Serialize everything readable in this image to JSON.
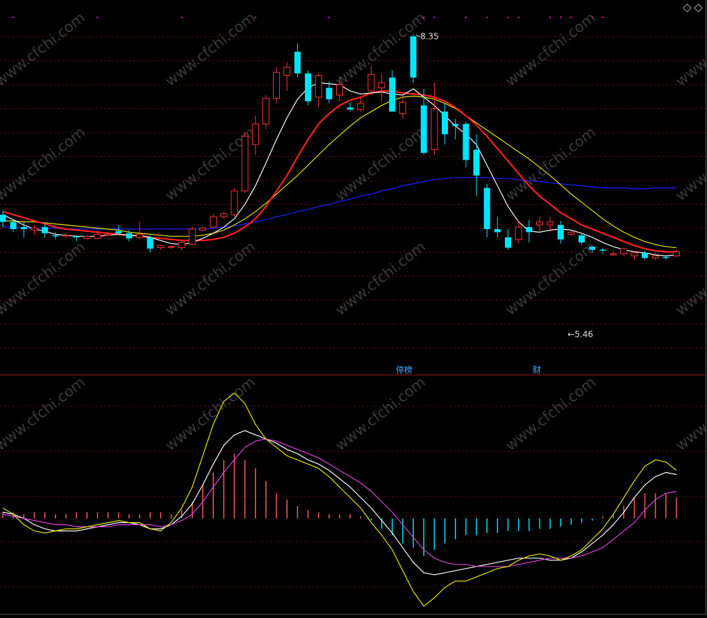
{
  "chart_data": [
    {
      "type": "candlestick",
      "title": "",
      "ylim": [
        5.2,
        8.5
      ],
      "x_count": 65,
      "colors": {
        "up": "#ff3333",
        "down": "#00e5ff",
        "ma5": "#ffffff",
        "ma10": "#ff2020",
        "ma20": "#e6e600",
        "ma60": "#2020ff"
      },
      "candles": [
        {
          "o": 6.62,
          "h": 6.66,
          "l": 6.5,
          "c": 6.55
        },
        {
          "o": 6.55,
          "h": 6.58,
          "l": 6.45,
          "c": 6.48
        },
        {
          "o": 6.5,
          "h": 6.55,
          "l": 6.4,
          "c": 6.48
        },
        {
          "o": 6.47,
          "h": 6.52,
          "l": 6.43,
          "c": 6.49
        },
        {
          "o": 6.5,
          "h": 6.54,
          "l": 6.4,
          "c": 6.44
        },
        {
          "o": 6.42,
          "h": 6.45,
          "l": 6.38,
          "c": 6.41
        },
        {
          "o": 6.42,
          "h": 6.44,
          "l": 6.39,
          "c": 6.42
        },
        {
          "o": 6.41,
          "h": 6.42,
          "l": 6.36,
          "c": 6.4
        },
        {
          "o": 6.39,
          "h": 6.42,
          "l": 6.38,
          "c": 6.41
        },
        {
          "o": 6.39,
          "h": 6.46,
          "l": 6.38,
          "c": 6.43
        },
        {
          "o": 6.42,
          "h": 6.45,
          "l": 6.41,
          "c": 6.43
        },
        {
          "o": 6.46,
          "h": 6.52,
          "l": 6.43,
          "c": 6.44
        },
        {
          "o": 6.44,
          "h": 6.47,
          "l": 6.36,
          "c": 6.39
        },
        {
          "o": 6.4,
          "h": 6.55,
          "l": 6.38,
          "c": 6.43
        },
        {
          "o": 6.4,
          "h": 6.42,
          "l": 6.25,
          "c": 6.29
        },
        {
          "o": 6.3,
          "h": 6.33,
          "l": 6.28,
          "c": 6.32
        },
        {
          "o": 6.31,
          "h": 6.32,
          "l": 6.29,
          "c": 6.31
        },
        {
          "o": 6.3,
          "h": 6.38,
          "l": 6.27,
          "c": 6.35
        },
        {
          "o": 6.33,
          "h": 6.5,
          "l": 6.32,
          "c": 6.48
        },
        {
          "o": 6.47,
          "h": 6.5,
          "l": 6.46,
          "c": 6.49
        },
        {
          "o": 6.5,
          "h": 6.63,
          "l": 6.49,
          "c": 6.6
        },
        {
          "o": 6.6,
          "h": 6.65,
          "l": 6.58,
          "c": 6.63
        },
        {
          "o": 6.62,
          "h": 6.88,
          "l": 6.6,
          "c": 6.85
        },
        {
          "o": 6.85,
          "h": 7.42,
          "l": 6.83,
          "c": 7.38
        },
        {
          "o": 7.3,
          "h": 7.58,
          "l": 7.2,
          "c": 7.5
        },
        {
          "o": 7.5,
          "h": 7.78,
          "l": 7.45,
          "c": 7.75
        },
        {
          "o": 7.75,
          "h": 8.05,
          "l": 7.7,
          "c": 8.0
        },
        {
          "o": 7.97,
          "h": 8.1,
          "l": 7.82,
          "c": 8.05
        },
        {
          "o": 8.2,
          "h": 8.28,
          "l": 7.95,
          "c": 7.99
        },
        {
          "o": 7.99,
          "h": 8.02,
          "l": 7.68,
          "c": 7.72
        },
        {
          "o": 7.76,
          "h": 7.99,
          "l": 7.66,
          "c": 7.97
        },
        {
          "o": 7.85,
          "h": 7.91,
          "l": 7.7,
          "c": 7.74
        },
        {
          "o": 7.78,
          "h": 7.96,
          "l": 7.72,
          "c": 7.88
        },
        {
          "o": 7.66,
          "h": 7.71,
          "l": 7.62,
          "c": 7.64
        },
        {
          "o": 7.64,
          "h": 7.76,
          "l": 7.62,
          "c": 7.7
        },
        {
          "o": 7.82,
          "h": 8.06,
          "l": 7.78,
          "c": 7.98
        },
        {
          "o": 7.85,
          "h": 7.99,
          "l": 7.72,
          "c": 7.9
        },
        {
          "o": 7.95,
          "h": 8.02,
          "l": 7.62,
          "c": 7.62
        },
        {
          "o": 7.6,
          "h": 7.78,
          "l": 7.55,
          "c": 7.71
        },
        {
          "o": 8.35,
          "h": 8.37,
          "l": 7.9,
          "c": 7.95
        },
        {
          "o": 7.68,
          "h": 7.84,
          "l": 7.2,
          "c": 7.22
        },
        {
          "o": 7.25,
          "h": 7.9,
          "l": 7.2,
          "c": 7.65
        },
        {
          "o": 7.62,
          "h": 7.7,
          "l": 7.3,
          "c": 7.4
        },
        {
          "o": 7.5,
          "h": 7.55,
          "l": 7.35,
          "c": 7.48
        },
        {
          "o": 7.5,
          "h": 7.52,
          "l": 7.08,
          "c": 7.15
        },
        {
          "o": 7.25,
          "h": 7.4,
          "l": 6.8,
          "c": 7.0
        },
        {
          "o": 6.88,
          "h": 6.92,
          "l": 6.4,
          "c": 6.48
        },
        {
          "o": 6.48,
          "h": 6.6,
          "l": 6.4,
          "c": 6.45
        },
        {
          "o": 6.4,
          "h": 6.48,
          "l": 6.28,
          "c": 6.3
        },
        {
          "o": 6.38,
          "h": 6.56,
          "l": 6.34,
          "c": 6.5
        },
        {
          "o": 6.5,
          "h": 6.57,
          "l": 6.35,
          "c": 6.45
        },
        {
          "o": 6.52,
          "h": 6.6,
          "l": 6.45,
          "c": 6.55
        },
        {
          "o": 6.52,
          "h": 6.6,
          "l": 6.45,
          "c": 6.55
        },
        {
          "o": 6.52,
          "h": 6.56,
          "l": 6.34,
          "c": 6.38
        },
        {
          "o": 6.43,
          "h": 6.47,
          "l": 6.41,
          "c": 6.45
        },
        {
          "o": 6.42,
          "h": 6.44,
          "l": 6.33,
          "c": 6.35
        },
        {
          "o": 6.31,
          "h": 6.3,
          "l": 6.25,
          "c": 6.28
        },
        {
          "o": 6.28,
          "h": 6.3,
          "l": 6.24,
          "c": 6.27
        },
        {
          "o": 6.23,
          "h": 6.27,
          "l": 6.22,
          "c": 6.24
        },
        {
          "o": 6.24,
          "h": 6.3,
          "l": 6.22,
          "c": 6.29
        },
        {
          "o": 6.22,
          "h": 6.27,
          "l": 6.18,
          "c": 6.25
        },
        {
          "o": 6.25,
          "h": 6.27,
          "l": 6.18,
          "c": 6.2
        },
        {
          "o": 6.2,
          "h": 6.25,
          "l": 6.18,
          "c": 6.22
        },
        {
          "o": 6.21,
          "h": 6.22,
          "l": 6.19,
          "c": 6.2
        },
        {
          "o": 6.22,
          "h": 6.28,
          "l": 6.21,
          "c": 6.26
        }
      ],
      "ma5": [
        6.62,
        6.57,
        6.52,
        6.48,
        6.46,
        6.43,
        6.42,
        6.41,
        6.41,
        6.41,
        6.42,
        6.43,
        6.42,
        6.42,
        6.4,
        6.37,
        6.34,
        6.33,
        6.35,
        6.39,
        6.44,
        6.5,
        6.58,
        6.72,
        6.9,
        7.12,
        7.35,
        7.56,
        7.74,
        7.85,
        7.9,
        7.89,
        7.88,
        7.82,
        7.79,
        7.8,
        7.81,
        7.79,
        7.78,
        7.84,
        7.76,
        7.68,
        7.58,
        7.48,
        7.4,
        7.3,
        7.1,
        6.9,
        6.7,
        6.55,
        6.46,
        6.45,
        6.47,
        6.48,
        6.47,
        6.44,
        6.4,
        6.35,
        6.31,
        6.28,
        6.26,
        6.25,
        6.23,
        6.22,
        6.23
      ],
      "ma10": [
        6.65,
        6.62,
        6.59,
        6.56,
        6.53,
        6.5,
        6.48,
        6.47,
        6.46,
        6.45,
        6.44,
        6.43,
        6.42,
        6.41,
        6.4,
        6.39,
        6.38,
        6.37,
        6.37,
        6.37,
        6.38,
        6.4,
        6.44,
        6.5,
        6.58,
        6.7,
        6.85,
        7.0,
        7.18,
        7.35,
        7.5,
        7.6,
        7.68,
        7.73,
        7.76,
        7.8,
        7.82,
        7.82,
        7.8,
        7.79,
        7.78,
        7.76,
        7.72,
        7.66,
        7.58,
        7.49,
        7.38,
        7.26,
        7.14,
        7.02,
        6.9,
        6.8,
        6.72,
        6.64,
        6.58,
        6.52,
        6.48,
        6.44,
        6.4,
        6.36,
        6.32,
        6.29,
        6.27,
        6.26,
        6.26
      ],
      "ma20": [
        6.56,
        6.56,
        6.55,
        6.55,
        6.54,
        6.53,
        6.52,
        6.51,
        6.5,
        6.49,
        6.48,
        6.47,
        6.45,
        6.44,
        6.43,
        6.42,
        6.41,
        6.41,
        6.41,
        6.42,
        6.44,
        6.47,
        6.52,
        6.58,
        6.65,
        6.73,
        6.82,
        6.91,
        7.0,
        7.1,
        7.2,
        7.3,
        7.39,
        7.48,
        7.56,
        7.62,
        7.68,
        7.73,
        7.76,
        7.77,
        7.76,
        7.74,
        7.7,
        7.65,
        7.58,
        7.51,
        7.44,
        7.37,
        7.3,
        7.23,
        7.16,
        7.08,
        7.0,
        6.91,
        6.82,
        6.74,
        6.66,
        6.58,
        6.51,
        6.45,
        6.4,
        6.36,
        6.33,
        6.31,
        6.3
      ],
      "ma60": [
        6.5,
        6.5,
        6.49,
        6.49,
        6.49,
        6.49,
        6.48,
        6.48,
        6.48,
        6.48,
        6.48,
        6.48,
        6.48,
        6.48,
        6.48,
        6.48,
        6.48,
        6.48,
        6.48,
        6.48,
        6.49,
        6.5,
        6.51,
        6.53,
        6.55,
        6.57,
        6.6,
        6.62,
        6.65,
        6.67,
        6.7,
        6.72,
        6.75,
        6.77,
        6.8,
        6.82,
        6.85,
        6.87,
        6.9,
        6.92,
        6.94,
        6.96,
        6.97,
        6.98,
        6.98,
        6.98,
        6.98,
        6.97,
        6.97,
        6.96,
        6.95,
        6.94,
        6.93,
        6.92,
        6.91,
        6.9,
        6.89,
        6.88,
        6.88,
        6.88,
        6.87,
        6.87,
        6.88,
        6.88,
        6.88
      ],
      "annotations": [
        {
          "label": "8.35",
          "x_index": 39,
          "y": 8.35
        },
        {
          "label": "←5.46",
          "x_index": 53,
          "y": 5.46
        }
      ],
      "badges": [
        {
          "label": "停榜",
          "x_index": 38
        },
        {
          "label": "财",
          "x_index": 51
        }
      ],
      "top_markers": [
        1,
        9,
        17,
        24,
        31,
        40,
        41,
        44,
        46,
        48,
        49,
        52,
        53,
        54,
        56,
        57
      ]
    },
    {
      "type": "macd",
      "title": "",
      "ylim": [
        -0.45,
        0.62
      ],
      "x_count": 65,
      "colors": {
        "dif": "#e6e600",
        "dea": "#e040e0",
        "k": "#ffffff",
        "hist_pos": "#ff5a5a",
        "hist_neg": "#00e5ff"
      },
      "dif": [
        0.05,
        0.02,
        -0.03,
        -0.06,
        -0.07,
        -0.06,
        -0.05,
        -0.05,
        -0.04,
        -0.03,
        -0.02,
        -0.01,
        -0.02,
        -0.02,
        -0.05,
        -0.06,
        -0.02,
        0.05,
        0.15,
        0.3,
        0.45,
        0.56,
        0.6,
        0.55,
        0.45,
        0.38,
        0.34,
        0.3,
        0.28,
        0.26,
        0.24,
        0.2,
        0.15,
        0.1,
        0.05,
        -0.02,
        -0.08,
        -0.15,
        -0.25,
        -0.35,
        -0.42,
        -0.38,
        -0.33,
        -0.3,
        -0.3,
        -0.28,
        -0.26,
        -0.24,
        -0.23,
        -0.2,
        -0.18,
        -0.17,
        -0.18,
        -0.2,
        -0.18,
        -0.15,
        -0.1,
        -0.05,
        0.02,
        0.1,
        0.18,
        0.25,
        0.28,
        0.27,
        0.23
      ],
      "dea": [
        0.02,
        0.01,
        0.0,
        -0.01,
        -0.02,
        -0.03,
        -0.03,
        -0.04,
        -0.04,
        -0.04,
        -0.04,
        -0.03,
        -0.03,
        -0.03,
        -0.03,
        -0.04,
        -0.03,
        -0.01,
        0.02,
        0.08,
        0.15,
        0.22,
        0.28,
        0.34,
        0.37,
        0.38,
        0.37,
        0.35,
        0.33,
        0.31,
        0.29,
        0.26,
        0.23,
        0.2,
        0.17,
        0.13,
        0.08,
        0.03,
        -0.03,
        -0.09,
        -0.15,
        -0.19,
        -0.21,
        -0.22,
        -0.22,
        -0.23,
        -0.23,
        -0.23,
        -0.23,
        -0.22,
        -0.21,
        -0.2,
        -0.19,
        -0.19,
        -0.19,
        -0.18,
        -0.16,
        -0.14,
        -0.1,
        -0.06,
        -0.02,
        0.04,
        0.09,
        0.12,
        0.13
      ],
      "k": [
        0.03,
        0.02,
        0.0,
        -0.03,
        -0.05,
        -0.06,
        -0.06,
        -0.06,
        -0.05,
        -0.04,
        -0.03,
        -0.02,
        -0.02,
        -0.03,
        -0.05,
        -0.05,
        -0.03,
        0.01,
        0.07,
        0.16,
        0.26,
        0.35,
        0.4,
        0.42,
        0.4,
        0.38,
        0.36,
        0.33,
        0.31,
        0.28,
        0.26,
        0.23,
        0.19,
        0.15,
        0.1,
        0.05,
        -0.01,
        -0.07,
        -0.14,
        -0.21,
        -0.26,
        -0.27,
        -0.26,
        -0.25,
        -0.24,
        -0.23,
        -0.22,
        -0.21,
        -0.2,
        -0.19,
        -0.19,
        -0.19,
        -0.2,
        -0.2,
        -0.19,
        -0.16,
        -0.12,
        -0.08,
        -0.03,
        0.03,
        0.1,
        0.16,
        0.2,
        0.22,
        0.21
      ],
      "hist": [
        0.03,
        0.03,
        0.02,
        0.03,
        0.03,
        0.02,
        0.02,
        0.03,
        0.03,
        0.03,
        0.03,
        0.03,
        0.02,
        0.02,
        0.03,
        0.03,
        0.02,
        0.04,
        0.08,
        0.16,
        0.22,
        0.28,
        0.31,
        0.28,
        0.24,
        0.18,
        0.12,
        0.09,
        0.06,
        0.04,
        0.03,
        0.02,
        0.02,
        0.02,
        0.01,
        -0.01,
        -0.05,
        -0.08,
        -0.12,
        -0.14,
        -0.18,
        -0.15,
        -0.12,
        -0.1,
        -0.08,
        -0.08,
        -0.07,
        -0.07,
        -0.06,
        -0.06,
        -0.06,
        -0.05,
        -0.05,
        -0.04,
        -0.03,
        -0.02,
        -0.01,
        0.01,
        0.02,
        0.06,
        0.1,
        0.12,
        0.12,
        0.12,
        0.1
      ]
    }
  ],
  "watermark": "www.cfchi.com"
}
